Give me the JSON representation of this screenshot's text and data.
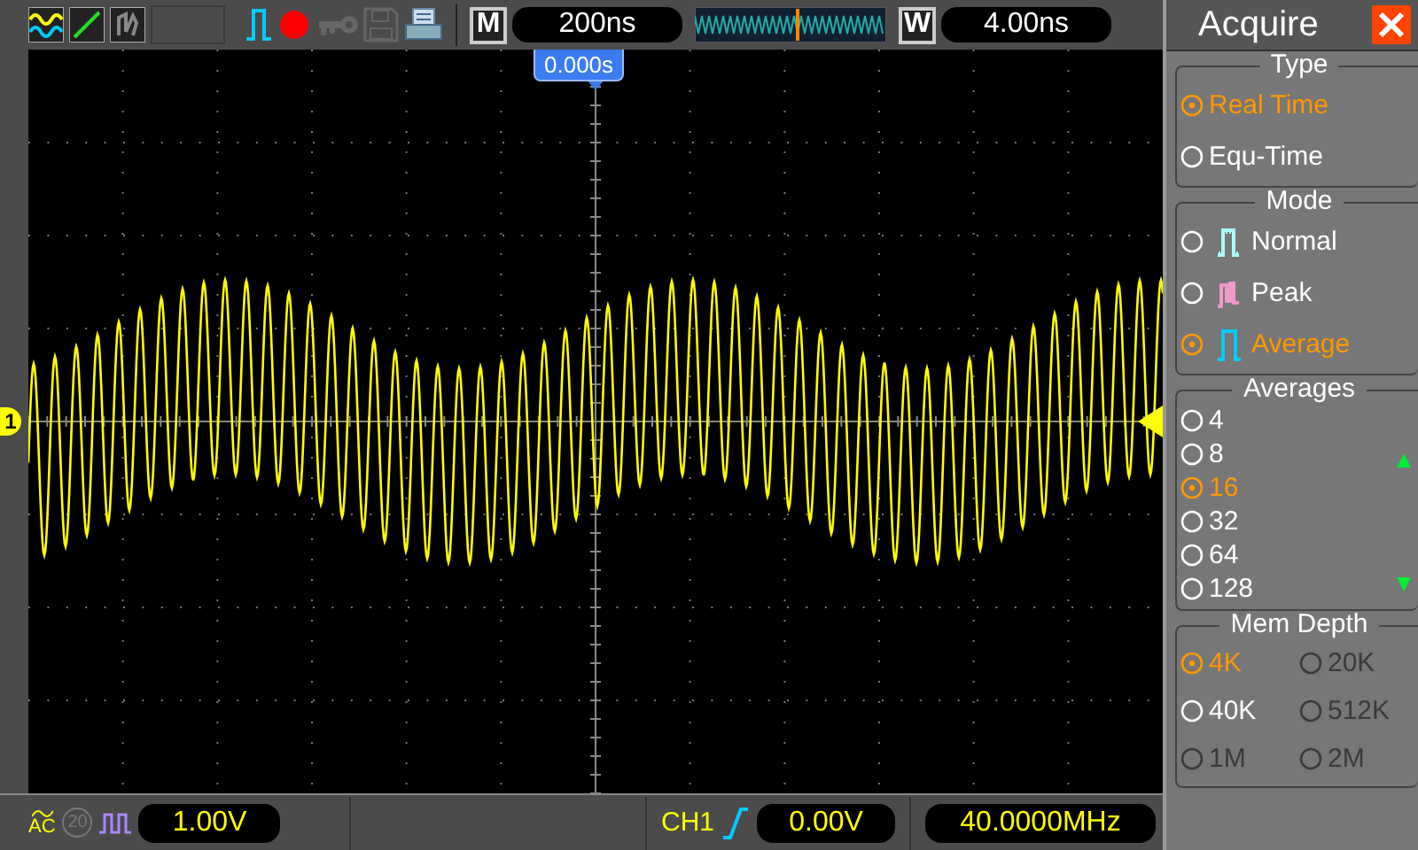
{
  "toolbar": {
    "timebase_label": "M",
    "timebase": "200ns",
    "window_label": "W",
    "window_timebase": "4.00ns"
  },
  "screen": {
    "trigger_position": "0.000s",
    "channel_marker": "1"
  },
  "status_bar": {
    "coupling": "AC",
    "bandwidth_limit": "20",
    "volts_per_div": "1.00V",
    "trigger_source": "CH1",
    "trigger_level": "0.00V",
    "frequency": "40.0000MHz"
  },
  "panel": {
    "title": "Acquire",
    "sections": [
      {
        "kind": "list",
        "title": "Type",
        "options": [
          {
            "label": "Real Time",
            "selected": true
          },
          {
            "label": "Equ-Time",
            "selected": false
          }
        ]
      },
      {
        "kind": "list",
        "title": "Mode",
        "options": [
          {
            "label": "Normal",
            "kind": "normal",
            "selected": false
          },
          {
            "label": "Peak",
            "kind": "peak",
            "selected": false
          },
          {
            "label": "Average",
            "kind": "average",
            "selected": true
          }
        ]
      },
      {
        "kind": "scroll",
        "title": "Averages",
        "options": [
          {
            "label": "4",
            "selected": false
          },
          {
            "label": "8",
            "selected": false
          },
          {
            "label": "16",
            "selected": true
          },
          {
            "label": "32",
            "selected": false
          },
          {
            "label": "64",
            "selected": false
          },
          {
            "label": "128",
            "selected": false
          }
        ]
      },
      {
        "kind": "grid",
        "title": "Mem Depth",
        "options": [
          {
            "label": "4K",
            "selected": true,
            "disabled": false
          },
          {
            "label": "20K",
            "selected": false,
            "disabled": true
          },
          {
            "label": "40K",
            "selected": false,
            "disabled": false
          },
          {
            "label": "512K",
            "selected": false,
            "disabled": true
          },
          {
            "label": "1M",
            "selected": false,
            "disabled": true
          },
          {
            "label": "2M",
            "selected": false,
            "disabled": true
          }
        ]
      }
    ]
  }
}
